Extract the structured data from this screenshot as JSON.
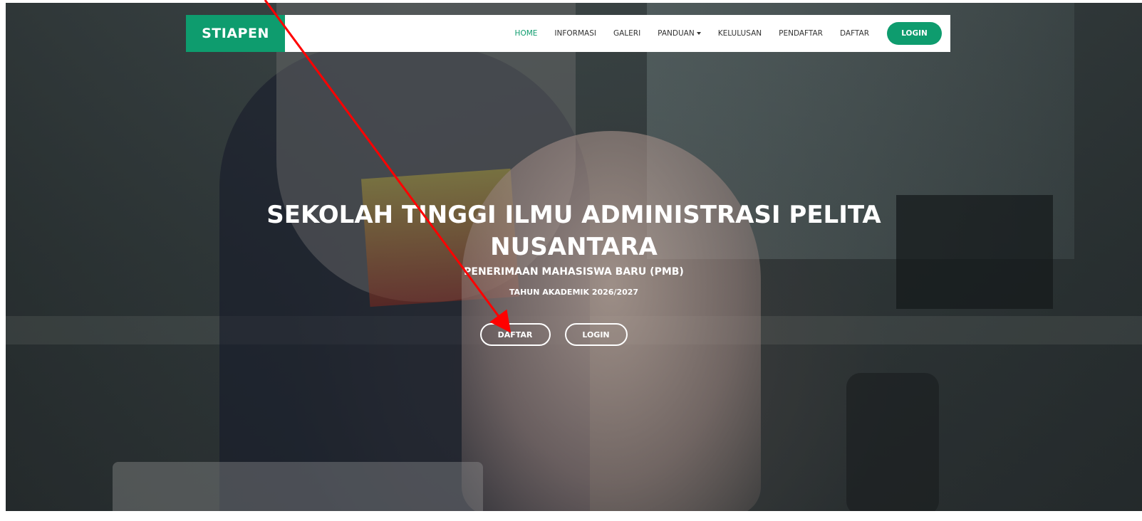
{
  "navbar": {
    "brand": "STIAPEN",
    "items": [
      {
        "label": "HOME",
        "active": true
      },
      {
        "label": "INFORMASI",
        "active": false
      },
      {
        "label": "GALERI",
        "active": false
      },
      {
        "label": "PANDUAN",
        "active": false,
        "has_dropdown": true
      },
      {
        "label": "KELULUSAN",
        "active": false
      },
      {
        "label": "PENDAFTAR",
        "active": false
      },
      {
        "label": "DAFTAR",
        "active": false
      }
    ],
    "login_label": "LOGIN"
  },
  "hero": {
    "title": "SEKOLAH TINGGI ILMU ADMINISTRASI PELITA NUSANTARA",
    "subtitle": "PENERIMAAN MAHASISWA BARU (PMB)",
    "academic_year": "TAHUN AKADEMIK 2026/2027",
    "buttons": {
      "daftar": "DAFTAR",
      "login": "LOGIN"
    }
  },
  "colors": {
    "brand_green": "#0e9c6e",
    "annotation_arrow": "#ff0000"
  }
}
